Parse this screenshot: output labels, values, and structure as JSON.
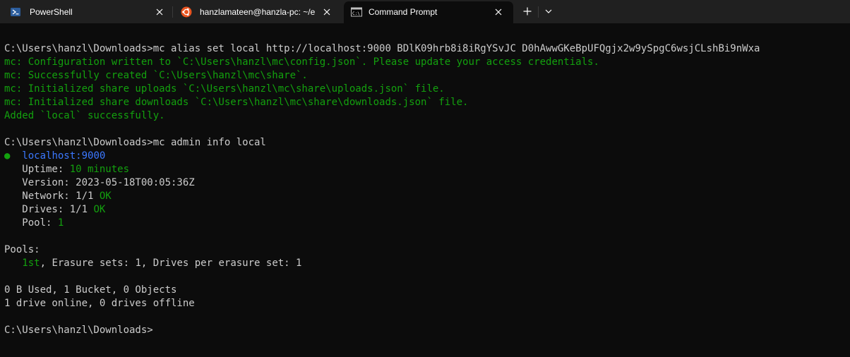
{
  "tabs": [
    {
      "label": "PowerShell",
      "icon": "powershell-icon",
      "active": false
    },
    {
      "label": "hanzlamateen@hanzla-pc: ~/e",
      "icon": "ubuntu-icon",
      "active": false
    },
    {
      "label": "Command Prompt",
      "icon": "cmd-icon",
      "active": true
    }
  ],
  "tabbar": {
    "new_tab_symbol": "+",
    "dropdown_icon": "chevron-down-icon"
  },
  "colors": {
    "background": "#0c0c0c",
    "tabbar": "#202020",
    "green": "#13a10e",
    "blue": "#3b78ff",
    "text": "#cccccc"
  },
  "terminal": {
    "cmd1_prompt": "C:\\Users\\hanzl\\Downloads>",
    "cmd1_text": "mc alias set local http://localhost:9000 BDlK09hrb8i8iRgYSvJC D0hAwwGKeBpUFQgjx2w9ySpgC6wsjCLshBi9nWxa",
    "out1": "mc: Configuration written to `C:\\Users\\hanzl\\mc\\config.json`. Please update your access credentials.",
    "out2": "mc: Successfully created `C:\\Users\\hanzl\\mc\\share`.",
    "out3": "mc: Initialized share uploads `C:\\Users\\hanzl\\mc\\share\\uploads.json` file.",
    "out4": "mc: Initialized share downloads `C:\\Users\\hanzl\\mc\\share\\downloads.json` file.",
    "out5": "Added `local` successfully.",
    "cmd2_prompt": "C:\\Users\\hanzl\\Downloads>",
    "cmd2_text": "mc admin info local",
    "server_bullet": "●",
    "server_name": "localhost:9000",
    "uptime_label": "   Uptime: ",
    "uptime_value": "10 minutes",
    "version_line": "   Version: 2023-05-18T00:05:36Z",
    "network_label": "   Network: 1/1 ",
    "network_status": "OK",
    "drives_label": "   Drives: 1/1 ",
    "drives_status": "OK",
    "pool_label": "   Pool: ",
    "pool_value": "1",
    "pools_header": "Pools:",
    "pools_indent": "   ",
    "pools_ordinal": "1st",
    "pools_rest": ", Erasure sets: 1, Drives per erasure set: 1",
    "usage_line": "0 B Used, 1 Bucket, 0 Objects",
    "drives_online_line": "1 drive online, 0 drives offline",
    "final_prompt": "C:\\Users\\hanzl\\Downloads>"
  }
}
